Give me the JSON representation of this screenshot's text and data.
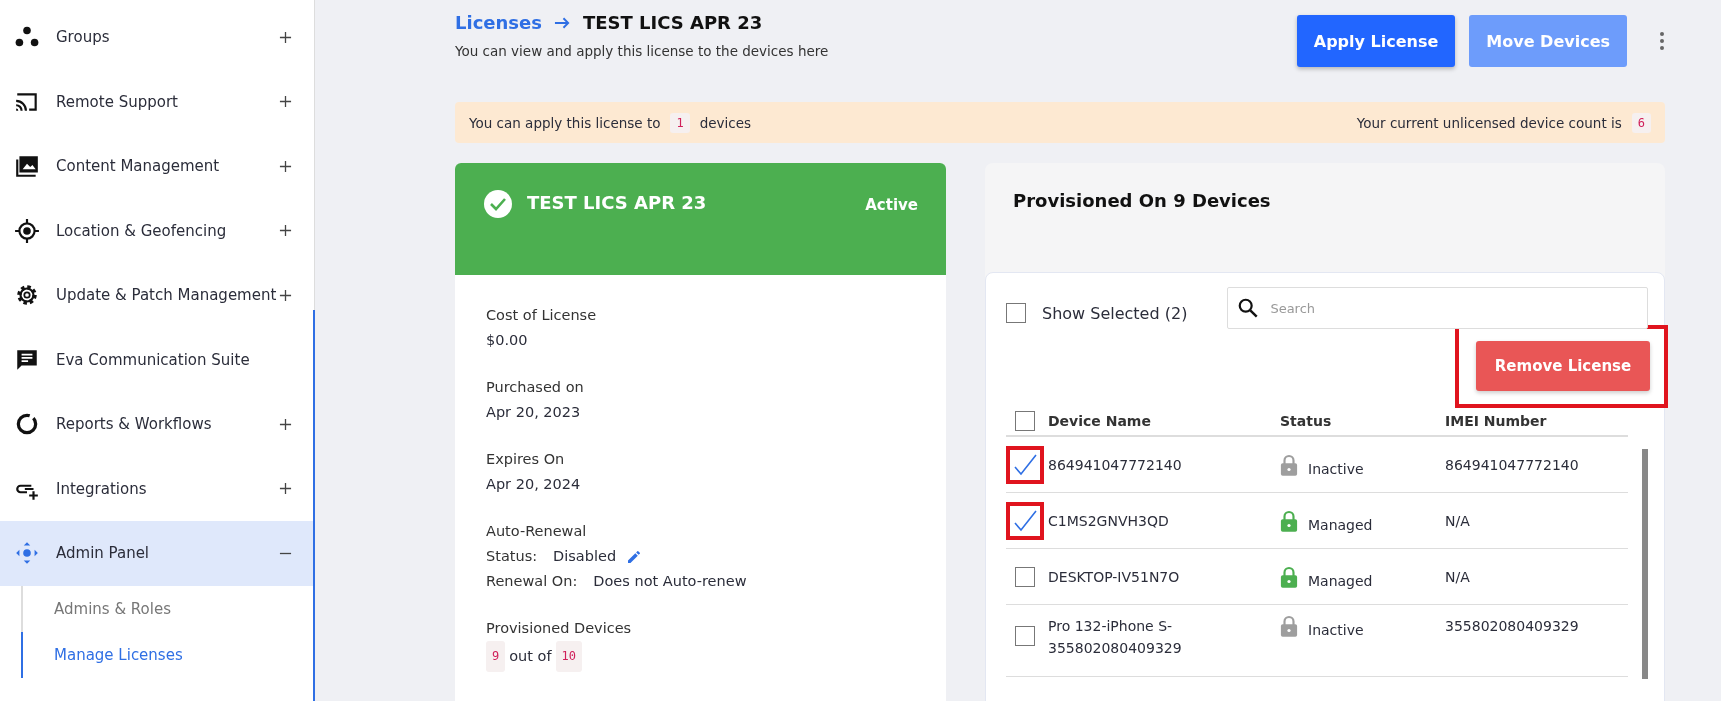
{
  "sidebar": {
    "items": [
      {
        "label": "Groups",
        "expandable": true,
        "expanded": false,
        "selected": false
      },
      {
        "label": "Remote Support",
        "expandable": true,
        "expanded": false,
        "selected": false
      },
      {
        "label": "Content Management",
        "expandable": true,
        "expanded": false,
        "selected": false
      },
      {
        "label": "Location & Geofencing",
        "expandable": true,
        "expanded": false,
        "selected": false
      },
      {
        "label": "Update & Patch Management",
        "expandable": true,
        "expanded": false,
        "selected": false
      },
      {
        "label": "Eva Communication Suite",
        "expandable": false,
        "selected": false
      },
      {
        "label": "Reports & Workflows",
        "expandable": true,
        "expanded": false,
        "selected": false
      },
      {
        "label": "Integrations",
        "expandable": true,
        "expanded": false,
        "selected": false
      },
      {
        "label": "Admin Panel",
        "expandable": true,
        "expanded": true,
        "selected": true,
        "children": [
          {
            "label": "Admins & Roles",
            "selected": false
          },
          {
            "label": "Manage Licenses",
            "selected": true
          }
        ]
      }
    ]
  },
  "header": {
    "breadcrumb": "Licenses",
    "title": "TEST LICS APR 23",
    "subtitle": "You can view and apply this license to the devices here",
    "buttons": [
      {
        "label": "Apply License",
        "disabled": false
      },
      {
        "label": "Move Devices",
        "disabled": true
      }
    ]
  },
  "banner": {
    "left_text": "You can apply this license to",
    "left_count": "1",
    "left_suffix": "devices",
    "right_text": "Your current unlicensed device count is",
    "right_count": "6"
  },
  "license_card": {
    "title": "TEST LICS APR 23",
    "status": "Active",
    "fields": [
      {
        "label": "Cost of License",
        "value": "$0.00"
      },
      {
        "label": "Purchased on",
        "value": "Apr 20, 2023"
      },
      {
        "label": "Expires On",
        "value": "Apr 20, 2024"
      }
    ],
    "auto_renewal": {
      "heading": "Auto-Renewal",
      "status_label": "Status:",
      "status_value": "Disabled",
      "renewal_label": "Renewal On:",
      "renewal_value": "Does not Auto-renew"
    },
    "provisioned": {
      "label": "Provisioned Devices",
      "count": "9",
      "between": "out of",
      "total": "10"
    }
  },
  "devices_panel": {
    "title": "Provisioned On 9 Devices",
    "show_selected": {
      "label": "Show Selected (2)",
      "checked": false
    },
    "search": {
      "placeholder": "Search"
    },
    "remove_button": {
      "label": "Remove License",
      "highlighted": true
    },
    "table": {
      "columns": [
        "Device Name",
        "Status",
        "IMEI Number"
      ],
      "all_checked": false,
      "rows": [
        {
          "device": "864941047772140",
          "status": "Inactive",
          "color": "#9e9e9e",
          "imei": "864941047772140",
          "checked": true,
          "highlighted": true
        },
        {
          "device": "C1MS2GNVH3QD",
          "status": "Managed",
          "color": "#4caf50",
          "imei": "N/A",
          "checked": true,
          "highlighted": true
        },
        {
          "device": "DESKTOP-IV51N7O",
          "status": "Managed",
          "color": "#4caf50",
          "imei": "N/A",
          "checked": false,
          "highlighted": false
        },
        {
          "device": "Pro 132-iPhone S-355802080409329",
          "status": "Inactive",
          "color": "#9e9e9e",
          "imei": "355802080409329",
          "checked": false,
          "highlighted": false
        }
      ]
    }
  }
}
